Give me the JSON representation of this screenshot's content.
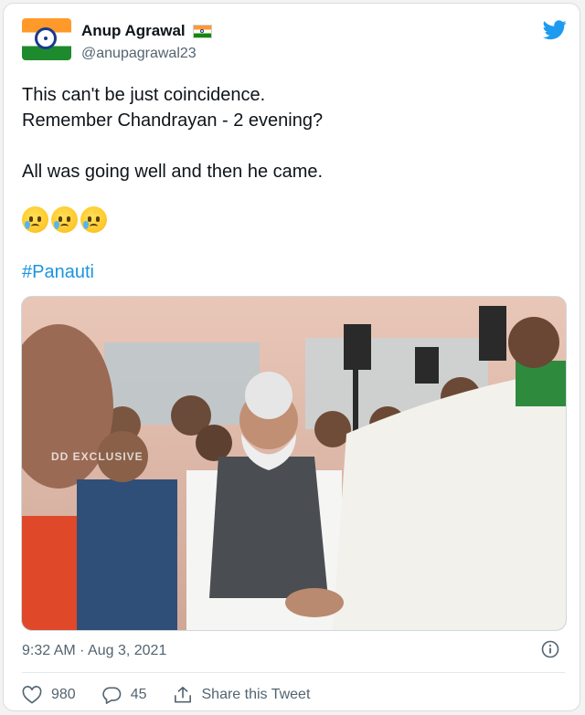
{
  "tweet": {
    "author_name": "Anup Agrawal",
    "author_handle": "@anupagrawal23",
    "text_lines": [
      "This can't be just coincidence.",
      "Remember Chandrayan - 2 evening?",
      "All was going well and then he came."
    ],
    "hashtag": "#Panauti",
    "video_watermark": "DD EXCLUSIVE",
    "timestamp": "9:32 AM · Aug 3, 2021"
  },
  "actions": {
    "likes": "980",
    "replies": "45",
    "share_label": "Share this Tweet"
  },
  "icons": {
    "brand": "twitter-bird-icon",
    "verified_flag": "india-flag-icon",
    "emoji": "crying-face-icon",
    "info": "info-icon",
    "like": "heart-icon",
    "reply": "reply-bubble-icon",
    "share": "share-icon"
  },
  "colors": {
    "twitter_blue": "#1d9bf0",
    "hashtag": "#1b95e0",
    "secondary_text": "#536471",
    "primary_text": "#0f1419"
  }
}
